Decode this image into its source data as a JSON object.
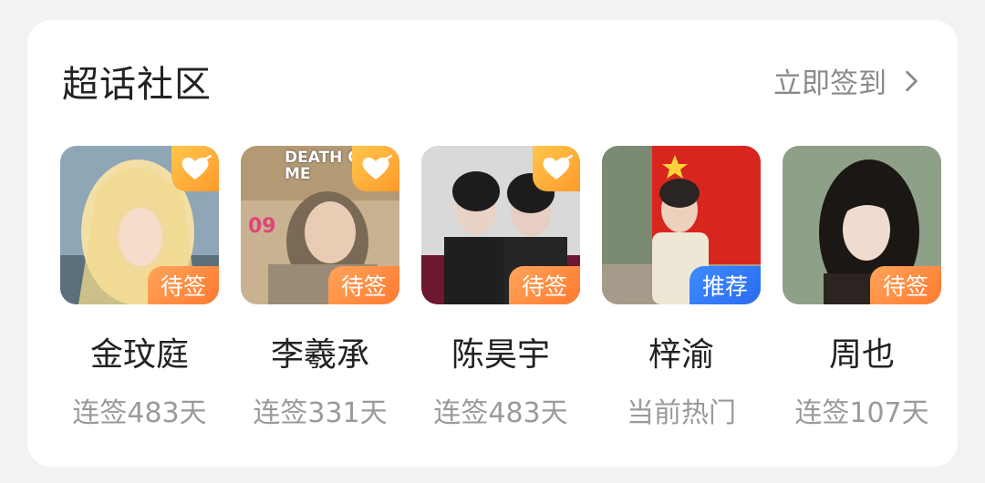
{
  "section": {
    "title": "超话社区",
    "action_label": "立即签到",
    "action_icon": "chevron-right-icon"
  },
  "items": [
    {
      "name": "金玟庭",
      "sub": "连签483天",
      "badge": "待签",
      "badge_color": "#ff8a3d",
      "favorite": true,
      "thumb_text": ""
    },
    {
      "name": "李羲承",
      "sub": "连签331天",
      "badge": "待签",
      "badge_color": "#ff8a3d",
      "favorite": true,
      "thumb_text": "DEATH OF ME"
    },
    {
      "name": "陈昊宇",
      "sub": "连签483天",
      "badge": "待签",
      "badge_color": "#ff8a3d",
      "favorite": true,
      "thumb_text": ""
    },
    {
      "name": "梓渝",
      "sub": "当前热门",
      "badge": "推荐",
      "badge_color": "#2f74f5",
      "favorite": false,
      "thumb_text": ""
    },
    {
      "name": "周也",
      "sub": "连签107天",
      "badge": "待签",
      "badge_color": "#ff8a3d",
      "favorite": false,
      "thumb_text": ""
    }
  ],
  "colors": {
    "accent_orange": "#ff8a3d",
    "accent_blue": "#2f74f5",
    "favorite_badge": "#ffb43c"
  }
}
